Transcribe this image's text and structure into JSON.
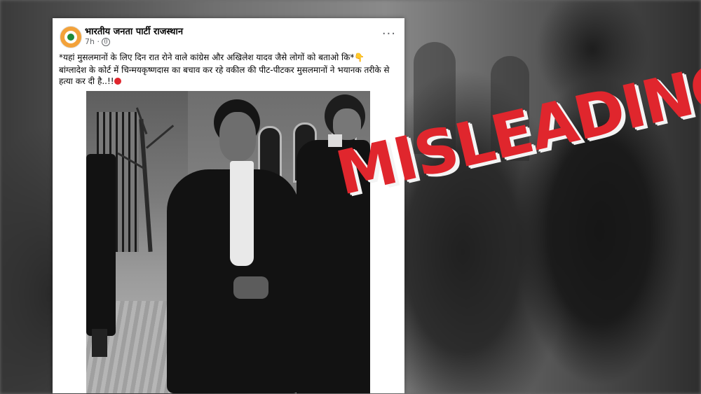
{
  "post": {
    "page_name": "भारतीय जनता पार्टी राजस्थान",
    "time": "7h ·",
    "line1": "*यहां मुसलमानों के लिए दिन रात रोने वाले कांग्रेस और अखिलेश यादव जैसे लोगों को बताओ कि*",
    "line2": "बांग्लादेश के कोर्ट में चिन्मयकृष्णदास का बचाव कर रहे वकील की पीट-पीटकर मुसलमानों ने भयानक तरीके से हत्या कर दी है..!!",
    "more_label": "···",
    "pointing_emoji": "👇",
    "red_circle_emoji": "🔴"
  },
  "stamp": {
    "text": "MISLEADING",
    "color": "#e0262d"
  },
  "icons": {
    "globe": "globe-icon",
    "more": "more-options-icon"
  }
}
